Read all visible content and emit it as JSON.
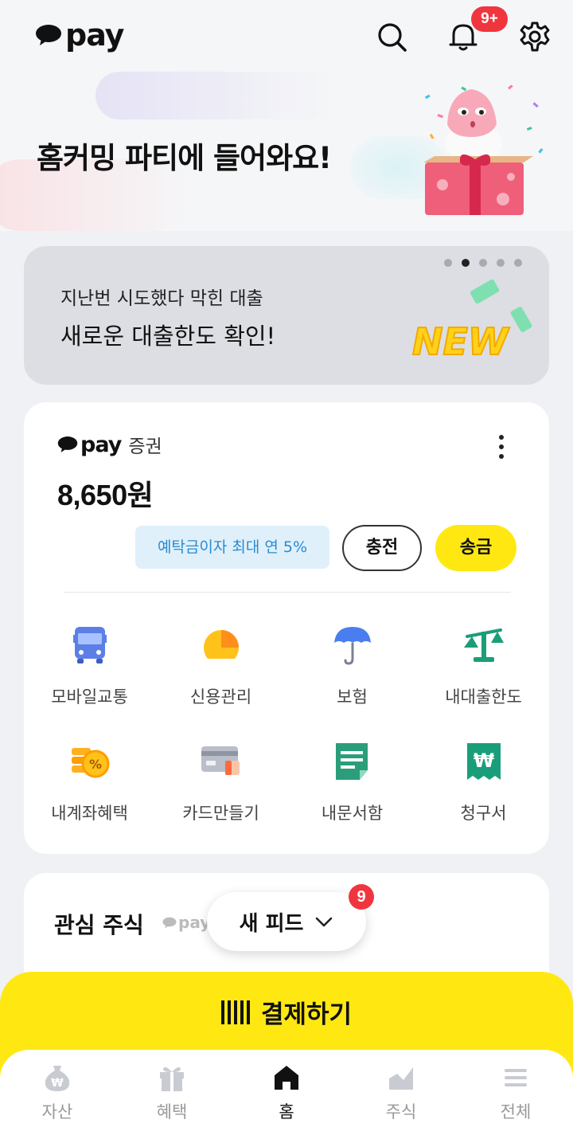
{
  "header": {
    "logo_text": "pay",
    "notification_badge": "9+",
    "hero_title": "홈커밍 파티에 들어와요!"
  },
  "loan_banner": {
    "subtitle": "지난번 시도했다 막힌 대출",
    "title": "새로운 대출한도 확인!",
    "page_count": 5,
    "active_page": 2,
    "art_text": "NEW"
  },
  "securities_card": {
    "brand": "pay",
    "brand_suffix": "증권",
    "balance": "8,650원",
    "interest_pill": "예탁금이자 최대 연 5%",
    "charge_label": "충전",
    "send_label": "송금"
  },
  "menu": [
    {
      "label": "모바일교통",
      "icon": "bus-icon"
    },
    {
      "label": "신용관리",
      "icon": "credit-score-icon"
    },
    {
      "label": "보험",
      "icon": "umbrella-icon"
    },
    {
      "label": "내대출한도",
      "icon": "scale-icon"
    },
    {
      "label": "내계좌혜택",
      "icon": "coins-percent-icon"
    },
    {
      "label": "카드만들기",
      "icon": "card-icon"
    },
    {
      "label": "내문서함",
      "icon": "document-icon"
    },
    {
      "label": "청구서",
      "icon": "bill-icon"
    }
  ],
  "watchlist": {
    "title": "관심 주식",
    "brand": "pay"
  },
  "feed": {
    "label": "새 피드",
    "badge": "9"
  },
  "pay_button": {
    "label": "결제하기"
  },
  "bottom_nav": [
    {
      "label": "자산",
      "icon": "money-bag-icon",
      "active": false
    },
    {
      "label": "혜택",
      "icon": "gift-icon",
      "active": false
    },
    {
      "label": "홈",
      "icon": "home-icon",
      "active": true
    },
    {
      "label": "주식",
      "icon": "stock-chart-icon",
      "active": false
    },
    {
      "label": "전체",
      "icon": "menu-icon",
      "active": false
    }
  ],
  "colors": {
    "brand_yellow": "#ffe812",
    "badge_red": "#f0353e",
    "interest_blue": "#2a8bd0",
    "background": "#f0f1f4"
  }
}
